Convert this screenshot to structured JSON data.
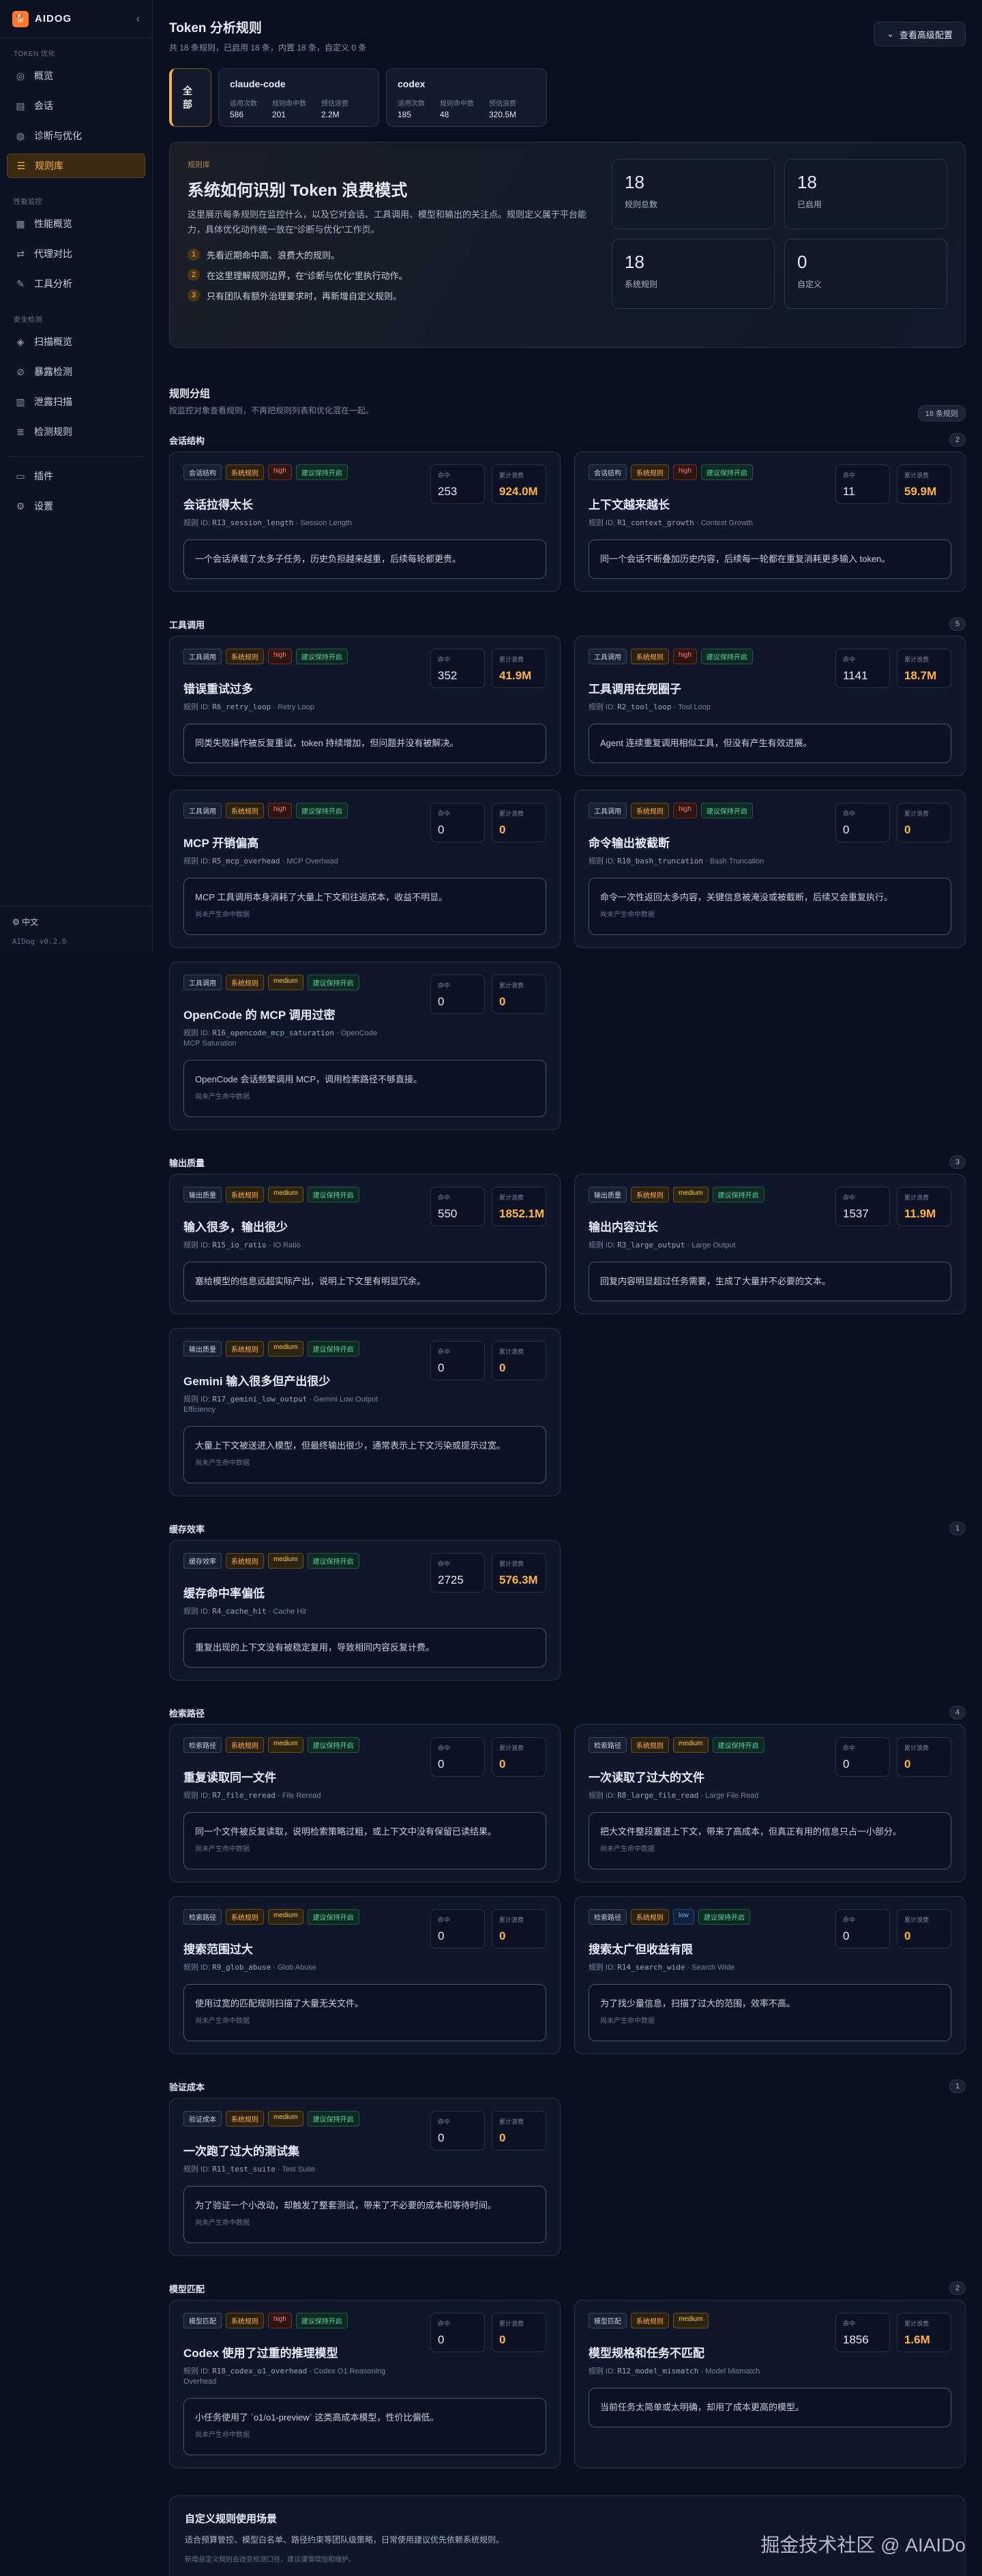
{
  "sidebar": {
    "brand": "AIDOG",
    "collapse_icon": "‹",
    "sections": [
      {
        "title": "TOKEN 优化",
        "items": [
          {
            "label": "概览",
            "icon": "◎"
          },
          {
            "label": "会话",
            "icon": "▤"
          },
          {
            "label": "诊断与优化",
            "icon": "◍"
          },
          {
            "label": "规则库",
            "icon": "☰",
            "active": true
          }
        ]
      },
      {
        "title": "性能监控",
        "items": [
          {
            "label": "性能概览",
            "icon": "▦"
          },
          {
            "label": "代理对比",
            "icon": "⇄"
          },
          {
            "label": "工具分析",
            "icon": "✎"
          }
        ]
      },
      {
        "title": "安全检测",
        "items": [
          {
            "label": "扫描概览",
            "icon": "◈"
          },
          {
            "label": "暴露检测",
            "icon": "⊘"
          },
          {
            "label": "泄露扫描",
            "icon": "▥"
          },
          {
            "label": "检测规则",
            "icon": "≣"
          }
        ]
      },
      {
        "title": "",
        "items": [
          {
            "label": "插件",
            "icon": "▭"
          },
          {
            "label": "设置",
            "icon": "⚙"
          }
        ]
      }
    ],
    "language": "中文",
    "version": "AIDog v0.2.0"
  },
  "header": {
    "title": "Token 分析规则",
    "subtitle": "共 18 条规则，已启用 18 条，内置 18 条，自定义 0 条",
    "advanced_button": "查看高级配置"
  },
  "agents": {
    "all_label": "全部",
    "items": [
      {
        "name": "claude-code",
        "stats": [
          {
            "label": "适用次数",
            "value": "586"
          },
          {
            "label": "规则命中数",
            "value": "201"
          },
          {
            "label": "预估浪费",
            "value": "2.2M"
          }
        ]
      },
      {
        "name": "codex",
        "stats": [
          {
            "label": "适用次数",
            "value": "185"
          },
          {
            "label": "规则命中数",
            "value": "48"
          },
          {
            "label": "预估浪费",
            "value": "320.5M"
          }
        ]
      }
    ]
  },
  "hero": {
    "kicker": "规则库",
    "title": "系统如何识别 Token 浪费模式",
    "description": "这里展示每条规则在监控什么，以及它对会话、工具调用、模型和输出的关注点。规则定义属于平台能力，具体优化动作统一放在“诊断与优化”工作页。",
    "steps": [
      "先看近期命中高、浪费大的规则。",
      "在这里理解规则边界，在“诊断与优化”里执行动作。",
      "只有团队有额外治理要求时，再新增自定义规则。"
    ],
    "stats": [
      {
        "value": "18",
        "label": "规则总数"
      },
      {
        "value": "18",
        "label": "已启用"
      },
      {
        "value": "18",
        "label": "系统规则"
      },
      {
        "value": "0",
        "label": "自定义"
      }
    ]
  },
  "rule_groups_section": {
    "title": "规则分组",
    "subtitle": "按监控对象查看规则，不再把规则列表和优化混在一起。",
    "count_label": "18 条规则"
  },
  "labels": {
    "hits": "命中",
    "waste": "累计浪费",
    "rule_id_prefix": "规则 ID:",
    "sys_tag": "系统规则",
    "enabled_tag": "建议保持开启",
    "no_history": "尚未产生命中数据"
  },
  "groups": [
    {
      "name": "会话结构",
      "count": "2",
      "rules": [
        {
          "tag": "会话结构",
          "severity": "high",
          "title": "会话拉得太长",
          "id": "R13_session_length",
          "en": "Session Length",
          "hits": "253",
          "waste": "924.0M",
          "desc": "一个会话承载了太多子任务，历史负担越来越重，后续每轮都更贵。",
          "empty": false
        },
        {
          "tag": "会话结构",
          "severity": "high",
          "title": "上下文越来越长",
          "id": "R1_context_growth",
          "en": "Context Growth",
          "hits": "11",
          "waste": "59.9M",
          "desc": "同一个会话不断叠加历史内容，后续每一轮都在重复消耗更多输入 token。",
          "empty": false
        }
      ]
    },
    {
      "name": "工具调用",
      "count": "5",
      "rules": [
        {
          "tag": "工具调用",
          "severity": "high",
          "title": "错误重试过多",
          "id": "R6_retry_loop",
          "en": "Retry Loop",
          "hits": "352",
          "waste": "41.9M",
          "desc": "同类失败操作被反复重试，token 持续增加，但问题并没有被解决。",
          "empty": false
        },
        {
          "tag": "工具调用",
          "severity": "high",
          "title": "工具调用在兜圈子",
          "id": "R2_tool_loop",
          "en": "Tool Loop",
          "hits": "1141",
          "waste": "18.7M",
          "desc": "Agent 连续重复调用相似工具，但没有产生有效进展。",
          "empty": false
        },
        {
          "tag": "工具调用",
          "severity": "high",
          "title": "MCP 开销偏高",
          "id": "R5_mcp_overhead",
          "en": "MCP Overhead",
          "hits": "0",
          "waste": "0",
          "desc": "MCP 工具调用本身消耗了大量上下文和往返成本，收益不明显。",
          "empty": true
        },
        {
          "tag": "工具调用",
          "severity": "high",
          "title": "命令输出被截断",
          "id": "R10_bash_truncation",
          "en": "Bash Truncation",
          "hits": "0",
          "waste": "0",
          "desc": "命令一次性返回太多内容，关键信息被淹没或被截断，后续又会重复执行。",
          "empty": true
        },
        {
          "tag": "工具调用",
          "severity": "medium",
          "title": "OpenCode 的 MCP 调用过密",
          "id": "R16_opencode_mcp_saturation",
          "en": "OpenCode MCP Saturation",
          "hits": "0",
          "waste": "0",
          "desc": "OpenCode 会话频繁调用 MCP，调用检索路径不够直接。",
          "empty": true
        }
      ]
    },
    {
      "name": "输出质量",
      "count": "3",
      "rules": [
        {
          "tag": "输出质量",
          "severity": "medium",
          "title": "输入很多，输出很少",
          "id": "R15_io_ratio",
          "en": "IO Ratio",
          "hits": "550",
          "waste": "1852.1M",
          "desc": "塞给模型的信息远超实际产出，说明上下文里有明显冗余。",
          "empty": false
        },
        {
          "tag": "输出质量",
          "severity": "medium",
          "title": "输出内容过长",
          "id": "R3_large_output",
          "en": "Large Output",
          "hits": "1537",
          "waste": "11.9M",
          "desc": "回复内容明显超过任务需要，生成了大量并不必要的文本。",
          "empty": false
        },
        {
          "tag": "输出质量",
          "severity": "medium",
          "title": "Gemini 输入很多但产出很少",
          "id": "R17_gemini_low_output",
          "en": "Gemini Low Output Efficiency",
          "hits": "0",
          "waste": "0",
          "desc": "大量上下文被送进入模型，但最终输出很少，通常表示上下文污染或提示过宽。",
          "empty": true
        }
      ]
    },
    {
      "name": "缓存效率",
      "count": "1",
      "rules": [
        {
          "tag": "缓存效率",
          "severity": "medium",
          "title": "缓存命中率偏低",
          "id": "R4_cache_hit",
          "en": "Cache Hit",
          "hits": "2725",
          "waste": "576.3M",
          "desc": "重复出现的上下文没有被稳定复用，导致相同内容反复计费。",
          "empty": false
        }
      ]
    },
    {
      "name": "检索路径",
      "count": "4",
      "rules": [
        {
          "tag": "检索路径",
          "severity": "medium",
          "title": "重复读取同一文件",
          "id": "R7_file_reread",
          "en": "File Reread",
          "hits": "0",
          "waste": "0",
          "desc": "同一个文件被反复读取，说明检索策略过粗，或上下文中没有保留已读结果。",
          "empty": true
        },
        {
          "tag": "检索路径",
          "severity": "medium",
          "title": "一次读取了过大的文件",
          "id": "R8_large_file_read",
          "en": "Large File Read",
          "hits": "0",
          "waste": "0",
          "desc": "把大文件整段塞进上下文，带来了高成本，但真正有用的信息只占一小部分。",
          "empty": true
        },
        {
          "tag": "检索路径",
          "severity": "medium",
          "title": "搜索范围过大",
          "id": "R9_glob_abuse",
          "en": "Glob Abuse",
          "hits": "0",
          "waste": "0",
          "desc": "使用过宽的匹配规则扫描了大量无关文件。",
          "empty": true
        },
        {
          "tag": "检索路径",
          "severity": "low",
          "title": "搜索太广但收益有限",
          "id": "R14_search_wide",
          "en": "Search Wide",
          "hits": "0",
          "waste": "0",
          "desc": "为了找少量信息，扫描了过大的范围，效率不高。",
          "empty": true
        }
      ]
    },
    {
      "name": "验证成本",
      "count": "1",
      "rules": [
        {
          "tag": "验证成本",
          "severity": "medium",
          "title": "一次跑了过大的测试集",
          "id": "R11_test_suite",
          "en": "Test Suite",
          "hits": "0",
          "waste": "0",
          "desc": "为了验证一个小改动，却触发了整套测试，带来了不必要的成本和等待时间。",
          "empty": true
        }
      ]
    },
    {
      "name": "模型匹配",
      "count": "2",
      "rules": [
        {
          "tag": "模型匹配",
          "severity": "high",
          "title": "Codex 使用了过重的推理模型",
          "id": "R18_codex_o1_overhead",
          "en": "Codex O1 Reasoning Overhead",
          "hits": "0",
          "waste": "0",
          "desc": "小任务使用了 `o1/o1-preview` 这类高成本模型，性价比偏低。",
          "empty": true
        },
        {
          "tag": "模型匹配",
          "severity": "medium",
          "title": "模型规格和任务不匹配",
          "id": "R12_model_mismatch",
          "en": "Model Mismatch",
          "hits": "1856",
          "waste": "1.6M",
          "desc": "当前任务太简单或太明确，却用了成本更高的模型。",
          "empty": false,
          "no_enabled": true
        }
      ]
    }
  ],
  "custom": {
    "title": "自定义规则使用场景",
    "description": "适合预算管控、模型白名单、路径约束等团队级策略，日常使用建议优先依赖系统规则。",
    "note": "新增自定义规则会改变检测口径，建议谨慎增加和维护。"
  },
  "watermark": "掘金技术社区 @ AIAIDo"
}
